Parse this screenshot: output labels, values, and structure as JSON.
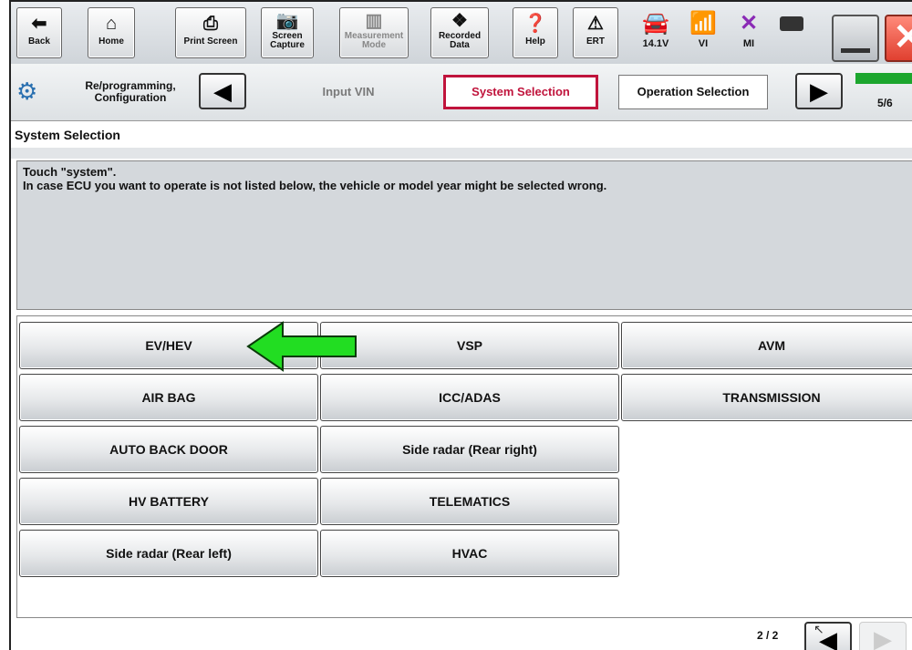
{
  "toolbar": {
    "back_label": "Back",
    "home_label": "Home",
    "print_label": "Print Screen",
    "capture_label": "Screen\nCapture",
    "measurement_label": "Measurement\nMode",
    "recorded_label": "Recorded\nData",
    "help_label": "Help",
    "ert_label": "ERT",
    "voltage": "14.1V",
    "vi_label": "VI",
    "mi_label": "MI"
  },
  "nav": {
    "title": "Re/programming,\nConfiguration",
    "crumbs": [
      "Input VIN",
      "System Selection",
      "Operation Selection"
    ],
    "page": "5/6",
    "progress_color": "#1ca62e"
  },
  "section_title": "System Selection",
  "message": {
    "line1": "Touch \"system\".",
    "line2": "In case ECU you want to operate is not listed below, the vehicle or model year might be selected wrong."
  },
  "systems": [
    [
      "EV/HEV",
      "VSP",
      "AVM"
    ],
    [
      "AIR BAG",
      "ICC/ADAS",
      "TRANSMISSION"
    ],
    [
      "AUTO BACK DOOR",
      "Side radar (Rear right)",
      ""
    ],
    [
      "HV BATTERY",
      "TELEMATICS",
      ""
    ],
    [
      "Side radar (Rear left)",
      "HVAC",
      ""
    ]
  ],
  "pager": {
    "text": "2 / 2"
  },
  "colors": {
    "active_crumb": "#c0143c",
    "arrow": "#22dd22"
  }
}
